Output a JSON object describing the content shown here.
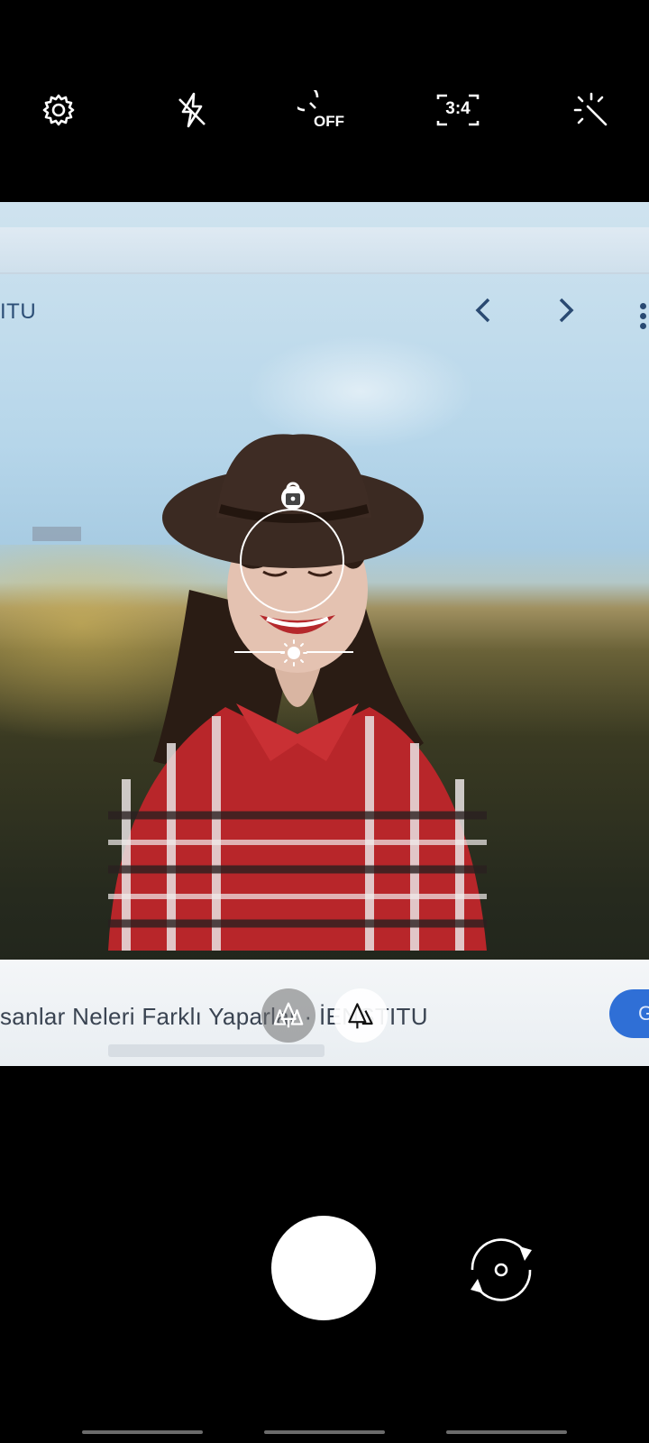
{
  "top_controls": [
    {
      "name": "settings",
      "icon": "gear-icon"
    },
    {
      "name": "flash",
      "icon": "flash-off-icon"
    },
    {
      "name": "timer",
      "icon": "timer-icon",
      "label": "OFF"
    },
    {
      "name": "ratio",
      "icon": "aspect-ratio-icon",
      "label": "3:4"
    },
    {
      "name": "effects",
      "icon": "magic-wand-icon"
    }
  ],
  "viewfinder": {
    "screen_header_text": "ITU",
    "caption_text": "sanlar Neleri Farklı Yaparlar ·  İENSTITU",
    "caption_button": "G"
  },
  "focus": {
    "lock_icon": "unlocked-icon",
    "exposure_icon": "sun-icon"
  },
  "modes": [
    {
      "name": "portrait-group",
      "icon": "trees-icon",
      "selected": false
    },
    {
      "name": "portrait-single",
      "icon": "tree-icon",
      "selected": true
    }
  ],
  "bottom_controls": {
    "shutter_icon": "shutter-button",
    "flip_icon": "switch-camera-icon"
  },
  "colors": {
    "background": "#000000",
    "accent": "#ffffff"
  }
}
